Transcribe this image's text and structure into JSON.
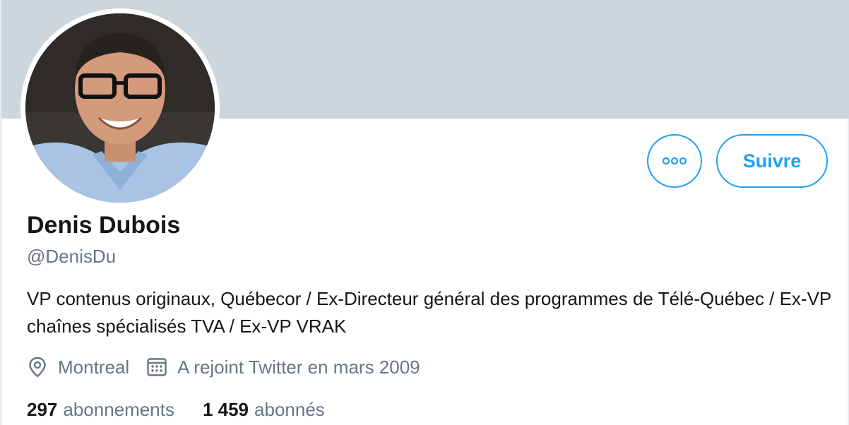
{
  "profile": {
    "name": "Denis Dubois",
    "handle": "@DenisDu",
    "bio": "VP contenus originaux, Québecor / Ex-Directeur général des programmes de Télé-Québec / Ex-VP chaînes spécialisés TVA / Ex-VP VRAK",
    "location": "Montreal",
    "joined": "A rejoint Twitter en mars 2009",
    "avatar_icon": "profile-photo"
  },
  "actions": {
    "more_icon": "more-dots-icon",
    "follow_label": "Suivre"
  },
  "stats": {
    "following_count": "297",
    "following_label": "abonnements",
    "followers_count": "1 459",
    "followers_label": "abonnés"
  },
  "colors": {
    "accent": "#1da1f2",
    "banner": "#ccd6dd",
    "secondary_text": "#657786",
    "primary_text": "#14171a"
  }
}
